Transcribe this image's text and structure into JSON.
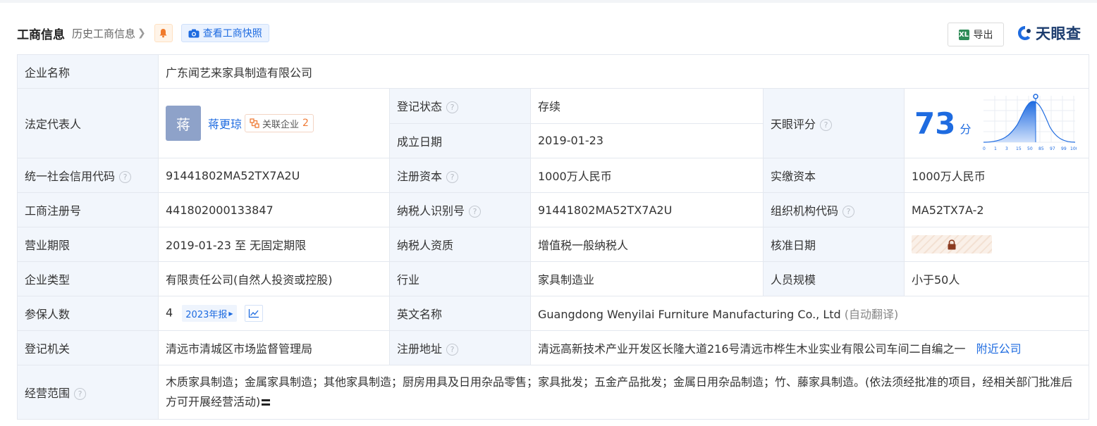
{
  "header": {
    "title": "工商信息",
    "history_label": "历史工商信息",
    "snapshot_label": "查看工商快照",
    "export_label": "导出",
    "export_icon": "XL",
    "brand": "天眼查"
  },
  "company": {
    "name_label": "企业名称",
    "name": "广东闻艺来家具制造有限公司",
    "legal_rep_label": "法定代表人",
    "legal_rep_avatar": "蒋",
    "legal_rep_name": "蒋更琼",
    "related_label": "关联企业",
    "related_count": "2",
    "status_label": "登记状态",
    "status": "存续",
    "found_date_label": "成立日期",
    "found_date": "2019-01-23",
    "score_label": "天眼评分",
    "score": "73",
    "score_unit": "分",
    "score_ticks": [
      "0",
      "1",
      "3",
      "15",
      "50",
      "85",
      "97",
      "99",
      "100"
    ],
    "credit_code_label": "统一社会信用代码",
    "credit_code": "91441802MA52TX7A2U",
    "reg_capital_label": "注册资本",
    "reg_capital": "1000万人民币",
    "paid_capital_label": "实缴资本",
    "paid_capital": "1000万人民币",
    "reg_no_label": "工商注册号",
    "reg_no": "441802000133847",
    "taxpayer_id_label": "纳税人识别号",
    "taxpayer_id": "91441802MA52TX7A2U",
    "org_code_label": "组织机构代码",
    "org_code": "MA52TX7A-2",
    "term_label": "营业期限",
    "term": "2019-01-23 至 无固定期限",
    "taxpayer_qual_label": "纳税人资质",
    "taxpayer_qual": "增值税一般纳税人",
    "approve_date_label": "核准日期",
    "type_label": "企业类型",
    "type": "有限责任公司(自然人投资或控股)",
    "industry_label": "行业",
    "industry": "家具制造业",
    "staff_label": "人员规模",
    "staff": "小于50人",
    "insured_label": "参保人数",
    "insured": "4",
    "insured_year": "2023年报",
    "en_name_label": "英文名称",
    "en_name": "Guangdong Wenyilai Furniture Manufacturing Co., Ltd",
    "en_name_note": "(自动翻译)",
    "authority_label": "登记机关",
    "authority": "清远市清城区市场监督管理局",
    "address_label": "注册地址",
    "address": "清远高新技术产业开发区长隆大道216号清远市桦生木业实业有限公司车间二自编之一",
    "nearby_label": "附近公司",
    "scope_label": "经营范围",
    "scope": "木质家具制造；金属家具制造；其他家具制造；厨房用具及日用杂品零售；家具批发；五金产品批发；金属日用杂品制造；竹、藤家具制造。(依法须经批准的项目，经相关部门批准后方可开展经营活动)"
  },
  "colors": {
    "accent": "#1e6be0",
    "label_bg": "#f2f6fc",
    "status_green": "#27a147",
    "border": "#e4e8ef"
  }
}
